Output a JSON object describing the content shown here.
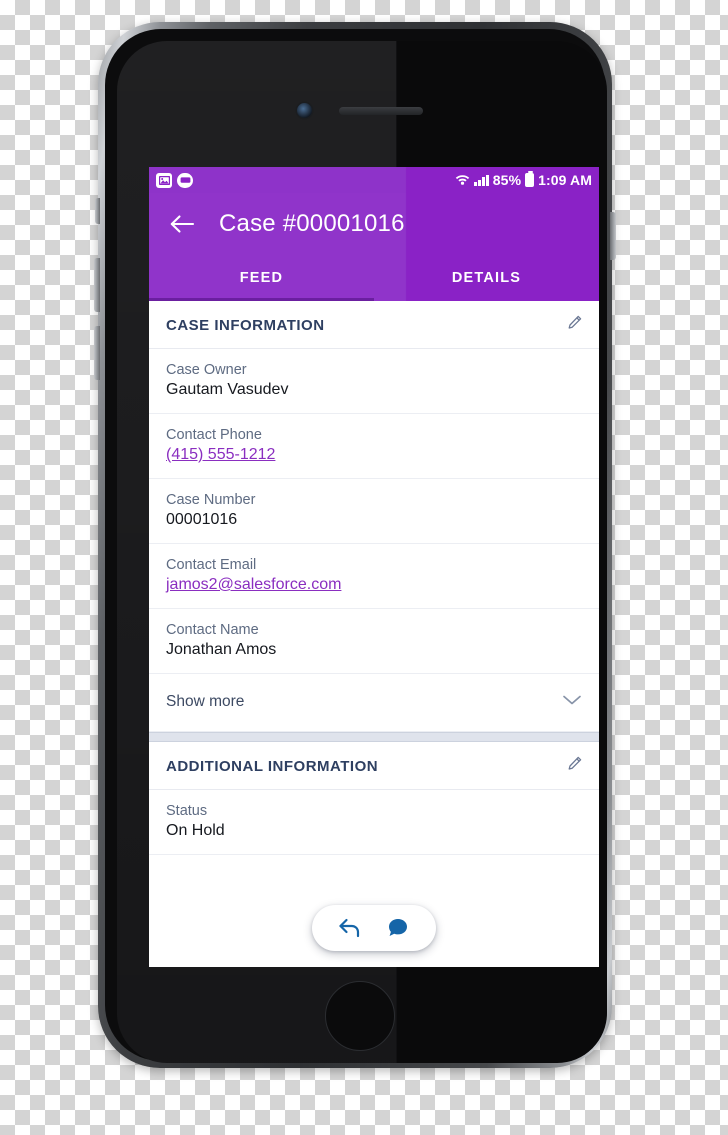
{
  "device": {
    "name": "iphone-mockup",
    "camera_icon": "front-camera",
    "speaker_icon": "earpiece-speaker",
    "home_button_label": "home-button"
  },
  "status_bar": {
    "left_icons": [
      {
        "name": "photo-notification-icon",
        "glyph": "❖"
      },
      {
        "name": "app-notification-icon",
        "glyph": "■"
      }
    ],
    "wifi_icon": "wifi-icon",
    "signal_icon": "cellular-signal-icon",
    "battery_percent": "85%",
    "battery_icon": "battery-icon",
    "time": "1:09 AM"
  },
  "app_bar": {
    "back_icon": "back-arrow-icon",
    "title": "Case #00001016"
  },
  "tabs": [
    {
      "label": "FEED",
      "active": true
    },
    {
      "label": "DETAILS",
      "active": false
    }
  ],
  "sections": [
    {
      "title": "CASE INFORMATION",
      "edit_icon": "pencil-edit-icon",
      "fields": [
        {
          "label": "Case Owner",
          "value": "Gautam Vasudev",
          "type": "text"
        },
        {
          "label": "Contact Phone",
          "value": "(415) 555-1212",
          "type": "link"
        },
        {
          "label": "Case Number",
          "value": "00001016",
          "type": "text"
        },
        {
          "label": "Contact Email",
          "value": "jamos2@salesforce.com",
          "type": "link"
        },
        {
          "label": "Contact Name",
          "value": "Jonathan Amos",
          "type": "text"
        }
      ],
      "show_more": {
        "label": "Show more",
        "icon": "chevron-down-icon"
      }
    },
    {
      "title": "ADDITIONAL INFORMATION",
      "edit_icon": "pencil-edit-icon",
      "fields": [
        {
          "label": "Status",
          "value": "On Hold",
          "type": "text"
        }
      ]
    }
  ],
  "fab": {
    "reply_icon": "reply-arrow-icon",
    "comment_icon": "chat-bubble-icon"
  },
  "colors": {
    "brand_purple": "#8a22c6",
    "brand_purple_light": "#9034ca",
    "tab_indicator": "#6b1fa0",
    "link_purple": "#8a2ec0",
    "label_gray": "#5e6b82",
    "heading_navy": "#2e3f61",
    "fab_blue": "#1565a8",
    "section_gap": "#dfe3ec"
  }
}
